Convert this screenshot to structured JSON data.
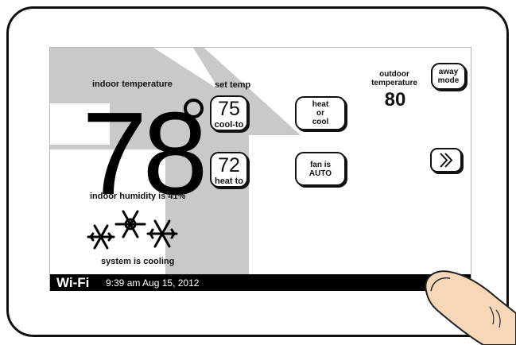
{
  "indoor": {
    "label": "indoor temperature",
    "temperature": "78",
    "humidity_text": "indoor humidity is 41%"
  },
  "set_temp": {
    "label": "set temp",
    "cool": {
      "value": "75",
      "label": "cool-to"
    },
    "heat": {
      "value": "72",
      "label": "heat to"
    }
  },
  "mode_button": {
    "line1": "heat",
    "line2": "or",
    "line3": "cool"
  },
  "fan_button": {
    "line1": "fan is",
    "line2": "AUTO"
  },
  "outdoor": {
    "label_line1": "outdoor",
    "label_line2": "temperature",
    "temperature": "80"
  },
  "away_button": {
    "line1": "away",
    "line2": "mode"
  },
  "status": {
    "text": "system is cooling",
    "icon": "snowflake-icon"
  },
  "statusbar": {
    "wifi": "Wi-Fi",
    "datetime": "9:39 am Aug 15, 2012"
  },
  "colors": {
    "screen_bg": "#ffffff",
    "accent_gray": "#c9c9c9",
    "statusbar": "#000000",
    "finger": "#f6d7b8"
  }
}
